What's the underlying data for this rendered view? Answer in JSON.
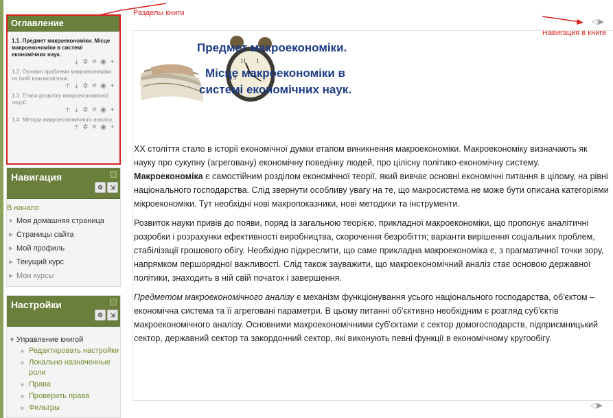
{
  "annotations": {
    "sections": "Разделы книги",
    "navigation": "Навигация в книге"
  },
  "toc": {
    "title": "Оглавление",
    "items": [
      {
        "label": "1.1. Предмет макроекономіки. Місце макроекономіки в системі економічних наук.",
        "active": true
      },
      {
        "label": "1.2. Основні проблеми макроекономіки та їхній взаємозв'язок."
      },
      {
        "label": "1.3. Етапи розвитку макроекономічної теорії."
      },
      {
        "label": "1.4. Методи макроекономічного аналізу."
      }
    ],
    "action_icons": [
      "arrow-up-icon",
      "arrow-down-icon",
      "gear-icon",
      "delete-icon",
      "eye-icon",
      "add-icon"
    ]
  },
  "navigation": {
    "title": "Навигация",
    "start_link": "В начало",
    "items": [
      "Моя домашняя страница",
      "Страницы сайта",
      "Мой профиль",
      "Текущий курс",
      "Мои курсы"
    ]
  },
  "settings": {
    "title": "Настройки",
    "group": "Управление книгой",
    "items": [
      "Редактировать настройки",
      "Локально назначенные роли",
      "Права",
      "Проверить права",
      "Фильтры"
    ]
  },
  "content": {
    "title_line1": "Предмет макроекономіки.",
    "title_line2": "Місце макроекономіки в системі економічних наук.",
    "p1_a": "XX століття стало в історії економічної думки етапом виникнення макроекономіки. Макроекономіку визначають як науку про сукупну (агреговану) економічну поведінку людей, про цілісну політико-економічну систему. ",
    "p1_bold": "Макроекономіка",
    "p1_b": " є самостійним розділом економічної теорії, який вивчає основні економічні питання в цілому, на рівні національного господарства. Слід звернути особливу увагу на те, що макросистема не може бути описана категоріями мікроекономіки. Тут необхідні нові макропоказники, нові методики та інструменти.",
    "p2": "Розвиток науки привів до появи, поряд із загальною теорією, прикладної макроекономіки, що пропонує аналітичні розробки і розрахунки ефективності виробництва, скорочення безробіття; варіанти вирішення соціальних проблем, стабілізації грошового обігу. Необхідно підкреслити, що саме прикладна макроекономіка є, з прагматичної точки зору, напрямком першорядної важливості. Слід також зауважити, що макроекономічний аналіз стає основою державної політики, знаходить в ній свій початок і завершення.",
    "p3_italic": "Предметом макроекономічного аналізу",
    "p3_rest": " є механізм функціонування усього національного господарства, об'єктом – економічна система та її агреговані параметри. В цьому питанні об'єктивно необхідним є розгляд суб'єктів макроекономічного аналізу. Основними макроекономічними суб'єктами є сектор домогосподарств, підприємницький сектор, державний сектор та закордонний сектор, які виконують певні функції в економічному кругообігу."
  }
}
